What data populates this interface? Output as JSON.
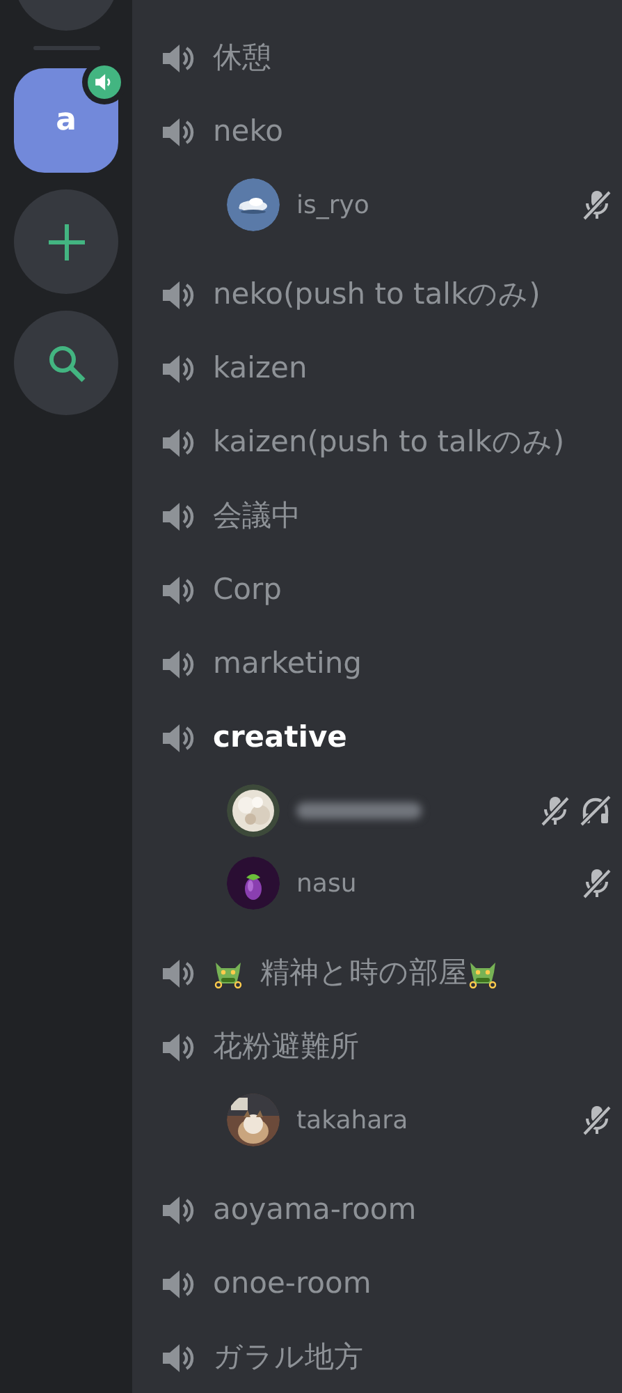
{
  "guilds": [
    {
      "kind": "home"
    },
    {
      "kind": "server",
      "label": "a",
      "selected": true,
      "speaking": true
    },
    {
      "kind": "add"
    },
    {
      "kind": "discover"
    }
  ],
  "channels": [
    {
      "kind": "plain",
      "name": "休憩",
      "connected": false
    },
    {
      "kind": "plain",
      "name": "neko",
      "connected": false,
      "users": [
        {
          "kind": "named",
          "name": "is_ryo",
          "muted": true,
          "deafened": false
        }
      ]
    },
    {
      "kind": "plain",
      "name": "neko(push to talkのみ)",
      "connected": false
    },
    {
      "kind": "plain",
      "name": "kaizen",
      "connected": false
    },
    {
      "kind": "plain",
      "name": "kaizen(push to talkのみ)",
      "connected": false
    },
    {
      "kind": "plain",
      "name": "会議中",
      "connected": false
    },
    {
      "kind": "plain",
      "name": "Corp",
      "connected": false
    },
    {
      "kind": "plain",
      "name": "marketing",
      "connected": false
    },
    {
      "kind": "plain",
      "name": "creative",
      "connected": true,
      "users": [
        {
          "kind": "blurred",
          "muted": true,
          "deafened": true
        },
        {
          "kind": "named",
          "name": "nasu",
          "muted": true,
          "deafened": false
        }
      ]
    },
    {
      "kind": "decorated",
      "name": "精神と時の部屋",
      "connected": false
    },
    {
      "kind": "plain",
      "name": "花粉避難所",
      "connected": false,
      "users": [
        {
          "kind": "named",
          "name": "takahara",
          "muted": true,
          "deafened": false
        }
      ]
    },
    {
      "kind": "plain",
      "name": "aoyama-room",
      "connected": false
    },
    {
      "kind": "plain",
      "name": "onoe-room",
      "connected": false
    },
    {
      "kind": "plain",
      "name": "ガラル地方",
      "connected": false
    }
  ]
}
